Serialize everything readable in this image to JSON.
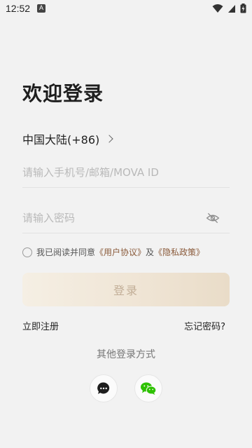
{
  "status_bar": {
    "time": "12:52"
  },
  "title": "欢迎登录",
  "region": {
    "label": "中国大陆(+86)"
  },
  "account_input": {
    "placeholder": "请输入手机号/邮箱/MOVA ID",
    "value": ""
  },
  "password_input": {
    "placeholder": "请输入密码",
    "value": ""
  },
  "agreement": {
    "prefix": "我已阅读并同意",
    "user_agreement": "《用户协议》",
    "and": "及",
    "privacy_policy": "《隐私政策》",
    "checked": false
  },
  "login_button": "登录",
  "register_link": "立即注册",
  "forgot_link": "忘记密码?",
  "other_methods_label": "其他登录方式",
  "social": {
    "sms_icon": "chat-bubble-icon",
    "wechat_icon": "wechat-icon"
  },
  "colors": {
    "background": "#f2f2f2",
    "link_brown": "#8a5a3a",
    "button_text": "#c2ae97",
    "wechat_green": "#2dc100"
  }
}
